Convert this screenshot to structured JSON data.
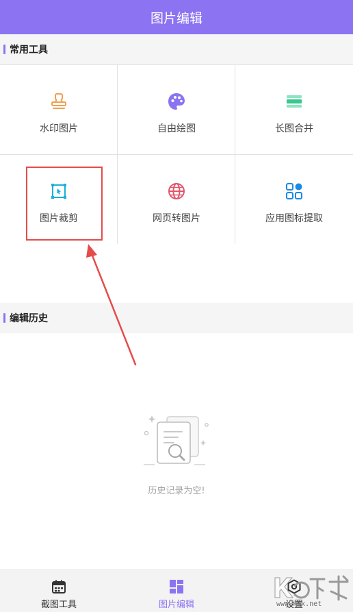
{
  "header": {
    "title": "图片编辑"
  },
  "sections": {
    "tools_title": "常用工具",
    "history_title": "编辑历史"
  },
  "tools": [
    {
      "label": "水印图片",
      "icon": "stamp-icon"
    },
    {
      "label": "自由绘图",
      "icon": "palette-icon"
    },
    {
      "label": "长图合并",
      "icon": "merge-lines-icon"
    },
    {
      "label": "图片裁剪",
      "icon": "crop-icon"
    },
    {
      "label": "网页转图片",
      "icon": "globe-icon"
    },
    {
      "label": "应用图标提取",
      "icon": "app-grid-icon"
    }
  ],
  "history": {
    "empty_text": "历史记录为空!"
  },
  "tabbar": {
    "items": [
      {
        "label": "截图工具",
        "icon": "calendar-icon",
        "active": false
      },
      {
        "label": "图片编辑",
        "icon": "dashboard-icon",
        "active": true
      },
      {
        "label": "设置",
        "icon": "hex-settings-icon",
        "active": false
      }
    ]
  },
  "watermark": {
    "domain": "www.kkx.net"
  },
  "colors": {
    "accent": "#8b73f2",
    "annotation": "#e54b4b"
  }
}
